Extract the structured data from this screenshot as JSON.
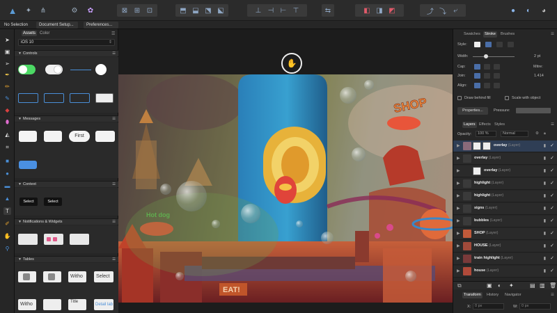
{
  "context_bar": {
    "selection": "No Selection",
    "document_setup": "Document Setup...",
    "preferences": "Preferences..."
  },
  "assets": {
    "tabs": [
      "Assets",
      "Color"
    ],
    "selected_set": "iOS 10",
    "categories": [
      {
        "name": "Controls"
      },
      {
        "name": "Messages"
      },
      {
        "name": "Context"
      },
      {
        "name": "Notifications & Widgets"
      },
      {
        "name": "Tables"
      }
    ],
    "message_labels": [
      "First"
    ],
    "context_labels": [
      "Select",
      "Select"
    ],
    "table_labels": [
      "Witho",
      "Select",
      "Witho",
      "Title",
      "Detail lab"
    ]
  },
  "canvas": {
    "sign_text": "EAT!",
    "shop_text": "SHOP",
    "hotdog_text": "Hot dog"
  },
  "stroke_panel": {
    "tabs": [
      "Swatches",
      "Stroke",
      "Brushes"
    ],
    "style_label": "Style:",
    "width_label": "Width:",
    "width_value": "2 pt",
    "cap_label": "Cap:",
    "join_label": "Join:",
    "align_label": "Align:",
    "mitre_label": "Mitre:",
    "mitre_value": "1.414",
    "draw_behind_label": "Draw behind fill",
    "scale_with_object_label": "Scale with object",
    "properties_label": "Properties...",
    "pressure_label": "Pressure:"
  },
  "layers_panel": {
    "tabs": [
      "Layers",
      "Effects",
      "Styles"
    ],
    "opacity_label": "Opacity:",
    "opacity_value": "100 %",
    "blend_mode": "Normal",
    "layers": [
      {
        "name": "overlay",
        "type": "(Layer)"
      },
      {
        "name": "overlay",
        "type": "(Layer)"
      },
      {
        "name": "overlay",
        "type": "(Layer)"
      },
      {
        "name": "highlight",
        "type": "(Layer)"
      },
      {
        "name": "highlight",
        "type": "(Layer)"
      },
      {
        "name": "signs",
        "type": "(Layer)"
      },
      {
        "name": "bubbles",
        "type": "(Layer)"
      },
      {
        "name": "SHOP",
        "type": "(Layer)"
      },
      {
        "name": "HOUSE",
        "type": "(Layer)"
      },
      {
        "name": "train highlight",
        "type": "(Layer)"
      },
      {
        "name": "house",
        "type": "(Layer)"
      }
    ]
  },
  "bottom_panel": {
    "tabs": [
      "Transform",
      "History",
      "Navigator"
    ],
    "x_label": "X:",
    "x_value": "0 px",
    "w_label": "W:",
    "w_value": "0 px"
  },
  "colors": {
    "accent": "#4a6ea8",
    "toggle_on": "#4cd964"
  }
}
